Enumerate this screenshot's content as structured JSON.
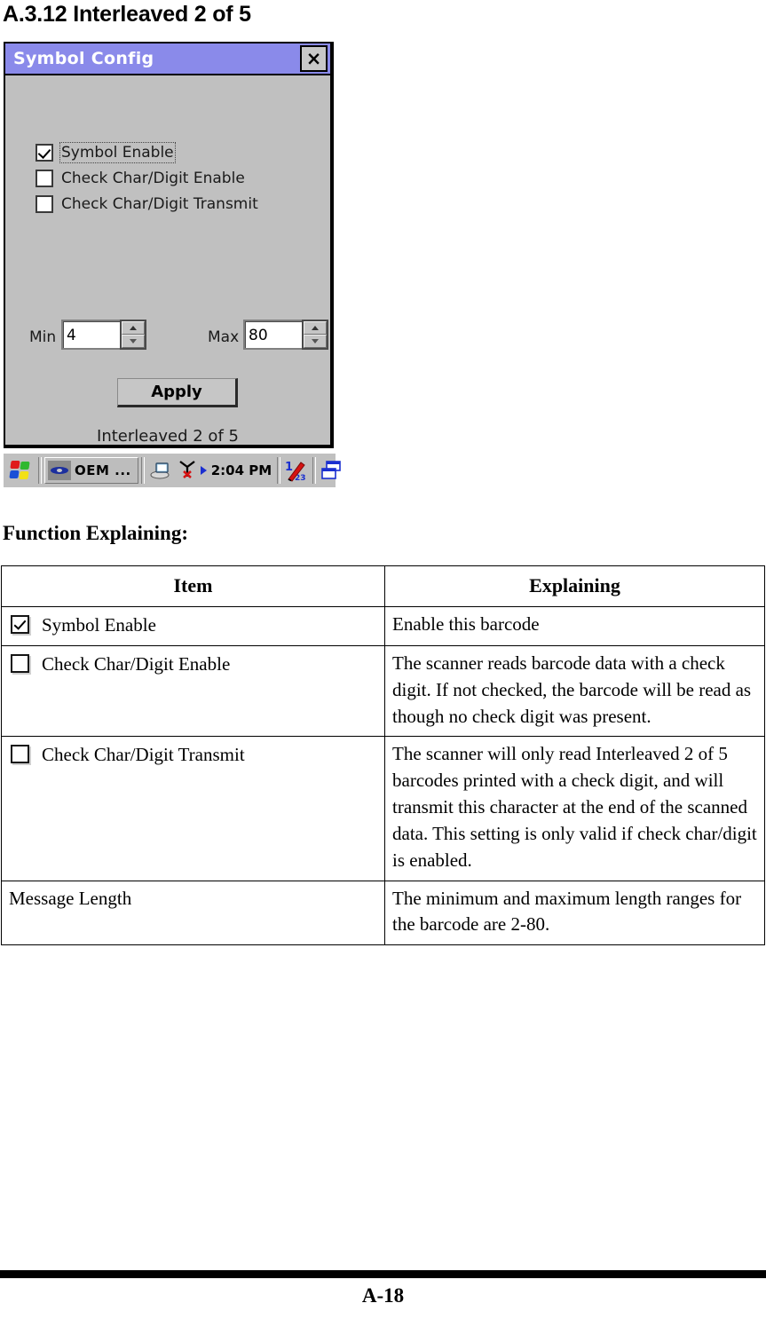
{
  "page": {
    "heading": "A.3.12 Interleaved 2 of 5",
    "function_heading": "Function Explaining:",
    "footer_page_number": "A-18"
  },
  "screenshot": {
    "window": {
      "title": "Symbol Config",
      "title_bar_color": "#8a8aea",
      "close_button_label": "×",
      "checkboxes": [
        {
          "label": "Symbol Enable",
          "checked": true,
          "focused": true
        },
        {
          "label": "Check Char/Digit Enable",
          "checked": false,
          "focused": false
        },
        {
          "label": "Check Char/Digit Transmit",
          "checked": false,
          "focused": false
        }
      ],
      "min_label": "Min",
      "min_value": "4",
      "max_label": "Max",
      "max_value": "80",
      "apply_label": "Apply",
      "caption": "Interleaved 2 of 5"
    },
    "taskbar": {
      "start_icon": "windows-flag-icon",
      "task_label": "OEM ...",
      "task_icon": "oem-icon",
      "tray_icons": [
        "desktop-pc-icon",
        "antenna-disconnected-icon",
        "input-panel-icon",
        "window-switch-icon"
      ],
      "clock": "2:04 PM"
    }
  },
  "table": {
    "headers": [
      "Item",
      "Explaining"
    ],
    "rows": [
      {
        "checkbox": true,
        "checked": true,
        "item": "Symbol Enable",
        "explaining": "Enable this barcode"
      },
      {
        "checkbox": true,
        "checked": false,
        "item": "Check Char/Digit Enable",
        "explaining": "The scanner reads barcode data with a check digit. If not checked, the barcode will be read as though no check digit was present."
      },
      {
        "checkbox": true,
        "checked": false,
        "item": "Check Char/Digit Transmit",
        "explaining": "The scanner will only read Interleaved 2 of 5 barcodes printed with a check digit, and will transmit this character at the end of the scanned data. This setting is only valid if check char/digit is enabled."
      },
      {
        "checkbox": false,
        "checked": false,
        "item": "Message Length",
        "explaining": "The minimum and maximum length ranges for the barcode are 2-80."
      }
    ]
  }
}
